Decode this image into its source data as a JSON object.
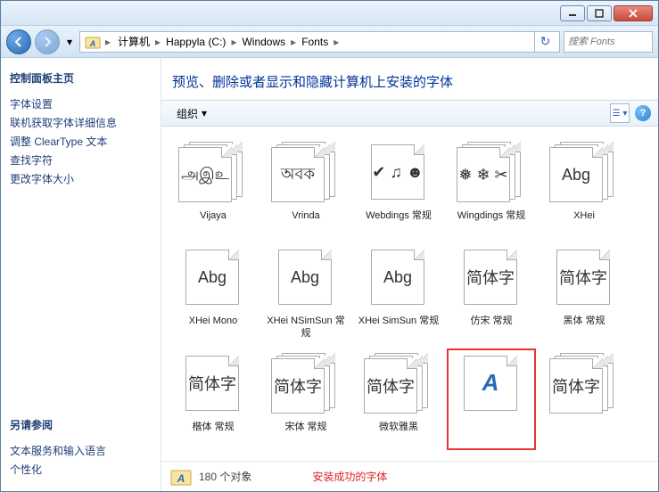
{
  "breadcrumb": [
    "计算机",
    "Happyla (C:)",
    "Windows",
    "Fonts"
  ],
  "search_placeholder": "搜索 Fonts",
  "sidebar": {
    "header": "控制面板主页",
    "links": [
      "字体设置",
      "联机获取字体详细信息",
      "调整 ClearType 文本",
      "查找字符",
      "更改字体大小"
    ],
    "see_also_header": "另请参阅",
    "see_also": [
      "文本服务和输入语言",
      "个性化"
    ]
  },
  "heading": "预览、删除或者显示和隐藏计算机上安装的字体",
  "toolbar": {
    "organize": "组织"
  },
  "fonts": [
    {
      "name": "Vijaya",
      "sample": "அஇஉ",
      "stack": true
    },
    {
      "name": "Vrinda",
      "sample": "অবক",
      "stack": true
    },
    {
      "name": "Webdings 常规",
      "sample": "✔ ♫ ☻",
      "stack": false
    },
    {
      "name": "Wingdings 常规",
      "sample": "❅ ❄ ✂",
      "stack": true
    },
    {
      "name": "XHei",
      "sample": "Abg",
      "stack": true
    },
    {
      "name": "XHei Mono",
      "sample": "Abg",
      "stack": false
    },
    {
      "name": "XHei NSimSun 常规",
      "sample": "Abg",
      "stack": false
    },
    {
      "name": "XHei SimSun 常规",
      "sample": "Abg",
      "stack": false
    },
    {
      "name": "仿宋 常规",
      "sample": "简体字",
      "stack": false
    },
    {
      "name": "黑体 常规",
      "sample": "简体字",
      "stack": false
    },
    {
      "name": "楷体 常规",
      "sample": "简体字",
      "stack": false
    },
    {
      "name": "宋体 常规",
      "sample": "简体字",
      "stack": true
    },
    {
      "name": "微软雅黑",
      "sample": "简体字",
      "stack": true
    },
    {
      "name": "",
      "sample": "A",
      "stack": false,
      "blueA": true,
      "highlight": true
    },
    {
      "name": "",
      "sample": "简体字",
      "stack": true
    }
  ],
  "status": {
    "count": "180 个对象",
    "note": "安装成功的字体"
  }
}
